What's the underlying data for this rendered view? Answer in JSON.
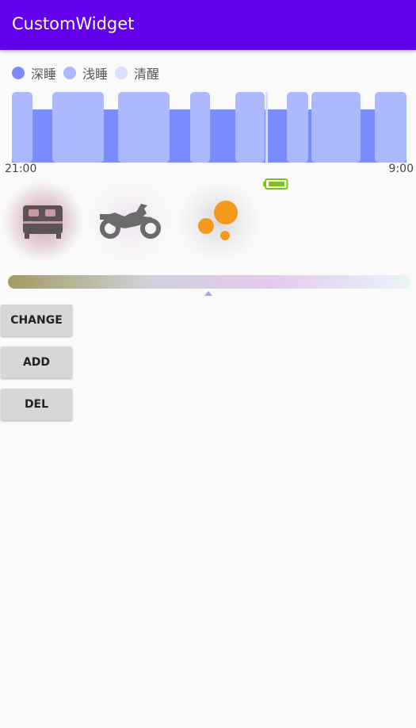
{
  "app_bar": {
    "title": "CustomWidget",
    "color": "#6200ee"
  },
  "sleep_chart": {
    "legend": [
      {
        "label": "深睡",
        "color": "#7b8cff"
      },
      {
        "label": "浅睡",
        "color": "#adb9ff"
      },
      {
        "label": "清醒",
        "color": "#d9e0ff"
      }
    ],
    "start_time": "21:00",
    "end_time": "9:00"
  },
  "battery": {
    "color": "#7cc613",
    "icon": "battery-icon"
  },
  "icons": [
    {
      "name": "bed-icon",
      "color": "#5b5355",
      "glow": "#c99aa3"
    },
    {
      "name": "motorcycle-icon",
      "color": "#6b6b6b",
      "glow": "#eee6ef"
    },
    {
      "name": "bubbles-icon",
      "color": "#f39a1e",
      "glow": "#d9d9d9"
    }
  ],
  "seek_bar": {
    "gradient": [
      "#a29b5f",
      "#cfd1da",
      "#e4c9ef",
      "#e8f5f7"
    ],
    "pointer_color": "#9fa6d8"
  },
  "buttons": {
    "change": "CHANGE",
    "add": "ADD",
    "del": "DEL"
  }
}
